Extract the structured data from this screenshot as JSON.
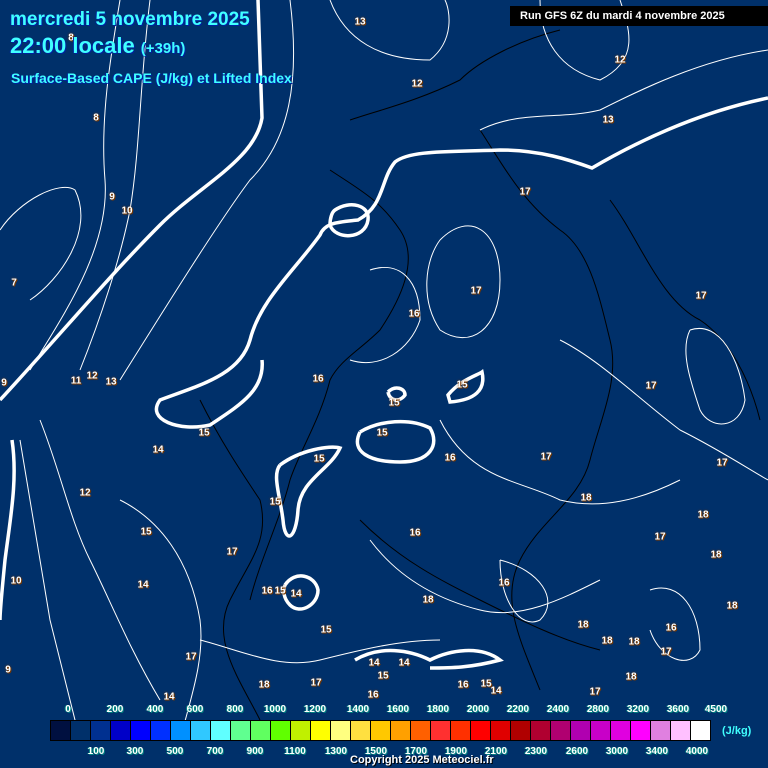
{
  "header": {
    "date": "mercredi 5 novembre 2025",
    "time": "22:00 locale",
    "offset": "(+39h)",
    "parameter": "Surface-Based CAPE (J/kg) et Lifted Index",
    "run": "Run GFS 6Z du mardi 4 novembre 2025"
  },
  "legend": {
    "unit": "(J/kg)",
    "colors": [
      "#001040",
      "#00306a",
      "#003090",
      "#0000c8",
      "#0000ff",
      "#0030ff",
      "#0090ff",
      "#30c8ff",
      "#60ffff",
      "#60ff90",
      "#60ff60",
      "#60ff00",
      "#c0f000",
      "#ffff00",
      "#ffff80",
      "#ffe040",
      "#ffc800",
      "#ffa000",
      "#ff6000",
      "#ff3030",
      "#ff3000",
      "#ff0000",
      "#e00000",
      "#b00000",
      "#b00030",
      "#b00070",
      "#b000b0",
      "#c800c8",
      "#e000e0",
      "#ff00ff",
      "#e080e0",
      "#ffc0ff",
      "#ffffff"
    ],
    "top_labels": [
      "0",
      "200",
      "400",
      "600",
      "800",
      "1000",
      "1200",
      "1400",
      "1600",
      "1800",
      "2000",
      "2200",
      "2400",
      "2800",
      "3200",
      "3600",
      "4500"
    ],
    "bottom_labels": [
      "100",
      "300",
      "500",
      "700",
      "900",
      "1100",
      "1300",
      "1500",
      "1700",
      "1900",
      "2100",
      "2300",
      "2600",
      "3000",
      "3400",
      "4000"
    ]
  },
  "lifted_index_labels": [
    "13",
    "12",
    "12",
    "8",
    "13",
    "9",
    "10",
    "17",
    "17",
    "17",
    "16",
    "7",
    "9",
    "11",
    "12",
    "13",
    "16",
    "15",
    "17",
    "15",
    "15",
    "15",
    "14",
    "15",
    "16",
    "17",
    "17",
    "12",
    "15",
    "18",
    "18",
    "15",
    "17",
    "16",
    "17",
    "18",
    "10",
    "14",
    "16",
    "15",
    "14",
    "16",
    "18",
    "18",
    "15",
    "18",
    "18",
    "18",
    "16",
    "17",
    "9",
    "17",
    "14",
    "14",
    "15",
    "18",
    "17",
    "16",
    "16",
    "15",
    "14",
    "17",
    "18",
    "14",
    "8"
  ],
  "copyright": "Copyright 2025 Meteociel.fr",
  "colors": {
    "background": "#00306a",
    "title": "#40ffff"
  }
}
